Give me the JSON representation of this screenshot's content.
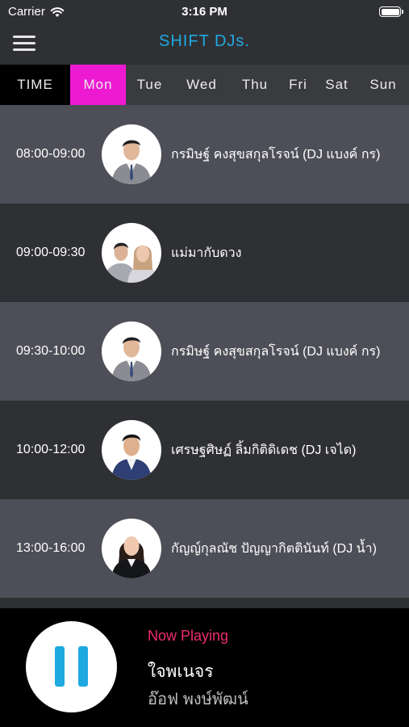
{
  "status": {
    "carrier": "Carrier",
    "time": "3:16 PM"
  },
  "nav": {
    "title": "SHIFT DJs."
  },
  "tabs": {
    "time": "TIME",
    "days": [
      "Mon",
      "Tue",
      "Wed",
      "Thu",
      "Fri",
      "Sat",
      "Sun"
    ],
    "selected": "Mon"
  },
  "schedule": [
    {
      "time": "08:00-09:00",
      "name": "กรมิษฐ์ คงสุขสกุลโรจน์ (DJ แบงค์ กร)"
    },
    {
      "time": "09:00-09:30",
      "name": "แม่มากับดวง"
    },
    {
      "time": "09:30-10:00",
      "name": "กรมิษฐ์ คงสุขสกุลโรจน์ (DJ แบงค์ กร)"
    },
    {
      "time": "10:00-12:00",
      "name": "เศรษฐศิษฏ์ ลิ้มกิติดิเดช (DJ เจได)"
    },
    {
      "time": "13:00-16:00",
      "name": "กัญญ์กุลณัช ปัญญากิตตินันท์ (DJ น้ำ)"
    }
  ],
  "player": {
    "now_playing_label": "Now Playing",
    "song_title": "ใจพเนจร",
    "artist": "อ๊อฟ พงษ์พัฒน์"
  },
  "colors": {
    "accent_blue": "#1fa9e1",
    "selected_tab": "#ee1ad2",
    "now_playing": "#ee2b6f",
    "row_light": "#4d4e57",
    "row_dark": "#2f3034"
  }
}
